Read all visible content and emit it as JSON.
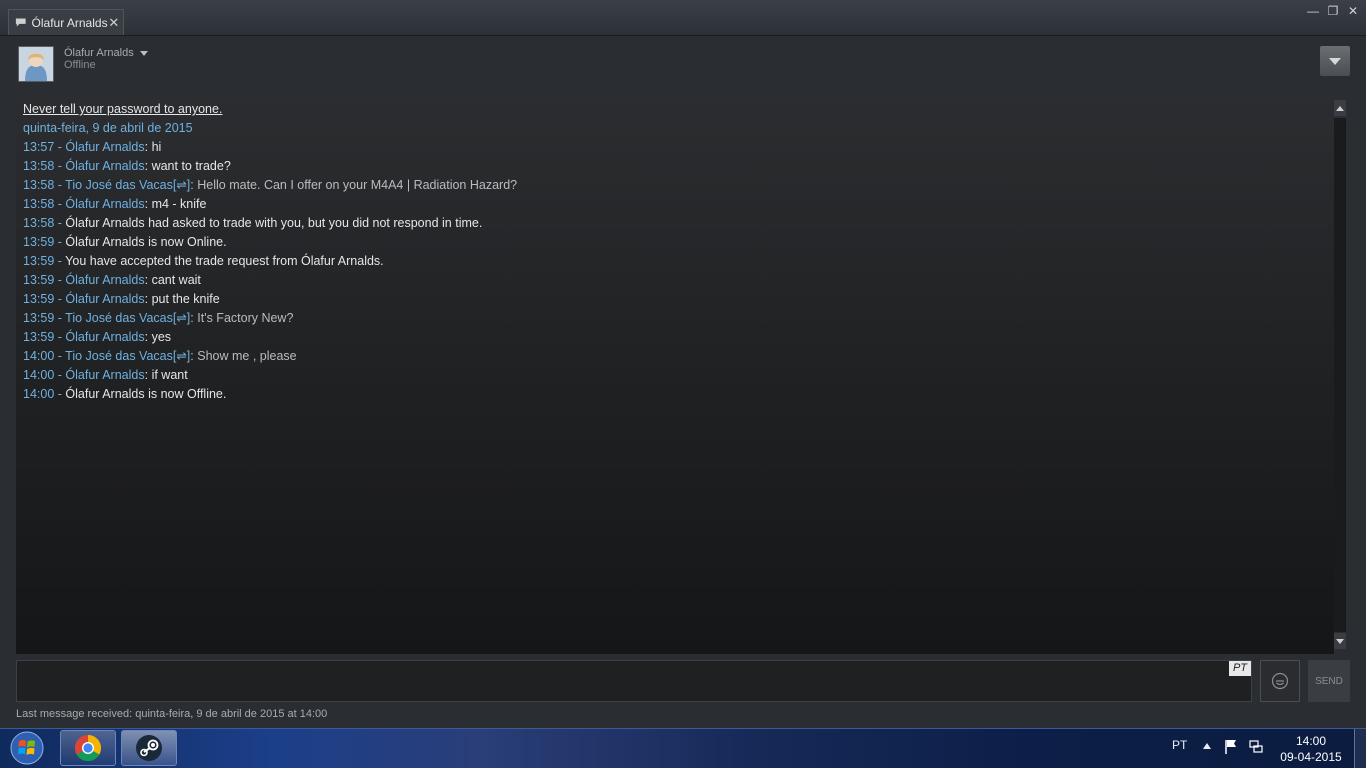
{
  "tab": {
    "title": "Ólafur Arnalds",
    "close": "✕"
  },
  "window_controls": {
    "minimize": "—",
    "restore": "❐",
    "close": "✕"
  },
  "friend": {
    "name": "Ólafur Arnalds",
    "status": "Offline"
  },
  "chat": {
    "warning": "Never tell your password to anyone.",
    "date": "quinta-feira, 9 de abril de 2015",
    "messages": [
      {
        "time": "13:57",
        "sep": " - ",
        "name": "Ólafur Arnalds",
        "colon": ": ",
        "text": "hi",
        "kind": "friend"
      },
      {
        "time": "13:58",
        "sep": " - ",
        "name": "Ólafur Arnalds",
        "colon": ": ",
        "text": "want to trade?",
        "kind": "friend"
      },
      {
        "time": "13:58",
        "sep": " - ",
        "name": "Tio José das Vacas[⇌]",
        "colon": ": ",
        "text": "Hello mate. Can I offer on your M4A4 | Radiation Hazard?",
        "kind": "me"
      },
      {
        "time": "13:58",
        "sep": " - ",
        "name": "Ólafur Arnalds",
        "colon": ": ",
        "text": "m4 - knife",
        "kind": "friend"
      },
      {
        "time": "13:58",
        "sep": " - ",
        "name": "",
        "colon": "",
        "text": "Ólafur Arnalds had asked to trade with you, but you did not respond in time.",
        "kind": "system"
      },
      {
        "time": "13:59",
        "sep": " - ",
        "name": "",
        "colon": "",
        "text": "Ólafur Arnalds is now Online.",
        "kind": "system"
      },
      {
        "time": "13:59",
        "sep": " - ",
        "name": "",
        "colon": "",
        "text": "You have accepted the trade request from Ólafur Arnalds.",
        "kind": "system"
      },
      {
        "time": "13:59",
        "sep": " - ",
        "name": "Ólafur Arnalds",
        "colon": ": ",
        "text": "cant wait",
        "kind": "friend"
      },
      {
        "time": "13:59",
        "sep": " - ",
        "name": "Ólafur Arnalds",
        "colon": ": ",
        "text": "put the knife",
        "kind": "friend"
      },
      {
        "time": "13:59",
        "sep": " - ",
        "name": "Tio José das Vacas[⇌]",
        "colon": ": ",
        "text": "It's Factory New?",
        "kind": "me"
      },
      {
        "time": "13:59",
        "sep": " - ",
        "name": "Ólafur Arnalds",
        "colon": ": ",
        "text": "yes",
        "kind": "friend"
      },
      {
        "time": "14:00",
        "sep": " - ",
        "name": "Tio José das Vacas[⇌]",
        "colon": ": ",
        "text": "Show me , please",
        "kind": "me"
      },
      {
        "time": "14:00",
        "sep": " - ",
        "name": "Ólafur Arnalds",
        "colon": ": ",
        "text": "if want",
        "kind": "friend"
      },
      {
        "time": "14:00",
        "sep": " - ",
        "name": "",
        "colon": "",
        "text": "Ólafur Arnalds is now Offline.",
        "kind": "system"
      }
    ]
  },
  "input": {
    "value": "",
    "lang": "PT"
  },
  "send_label": "SEND",
  "last_message": "Last message received: quinta-feira, 9 de abril de 2015 at 14:00",
  "taskbar": {
    "lang": "PT",
    "time": "14:00",
    "date": "09-04-2015"
  },
  "colors": {
    "accent": "#6fb1e0",
    "background": "#2a2d31",
    "taskbar": "#1c3f8a"
  },
  "icons": [
    "chat-icon",
    "chevron-down-icon",
    "emoticon-icon",
    "windows-start-icon",
    "chrome-icon",
    "steam-icon",
    "flag-icon",
    "network-icon"
  ]
}
